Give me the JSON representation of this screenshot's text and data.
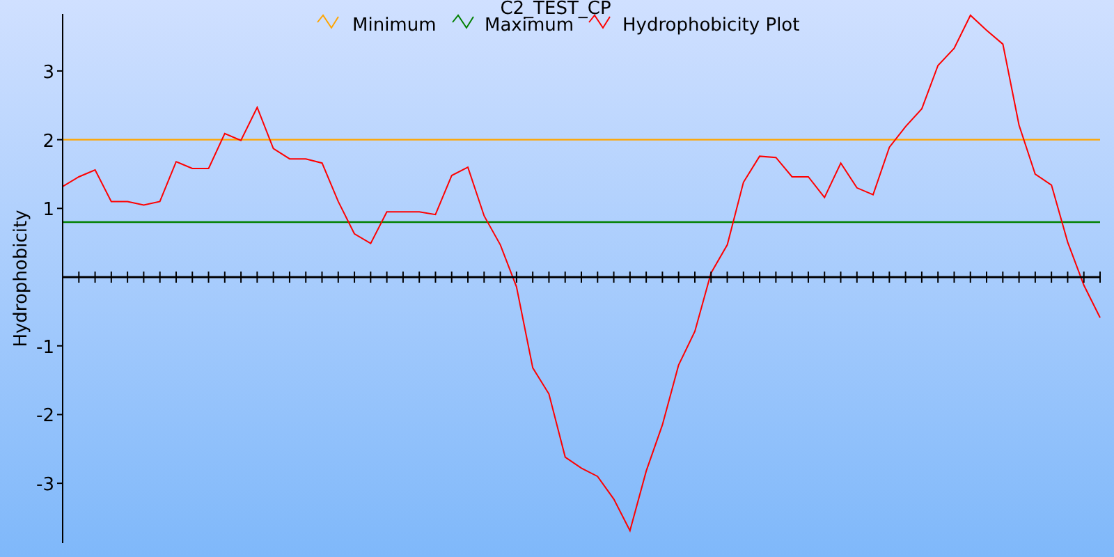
{
  "chart_data": {
    "type": "line",
    "title": "C2_TEST_CP",
    "ylabel": "Hydrophobicity",
    "legend": true,
    "ylim": [
      -3.87,
      3.83
    ],
    "yticks": [
      -3,
      -2,
      -1,
      1,
      2,
      3
    ],
    "series": [
      {
        "name": "Minimum",
        "color": "#ffa500",
        "values": [
          2,
          2,
          2,
          2,
          2,
          2,
          2,
          2,
          2,
          2,
          2,
          2,
          2,
          2,
          2,
          2,
          2,
          2,
          2,
          2,
          2,
          2,
          2,
          2,
          2,
          2,
          2,
          2,
          2,
          2,
          2,
          2,
          2,
          2,
          2,
          2,
          2,
          2,
          2,
          2,
          2,
          2,
          2,
          2,
          2,
          2,
          2,
          2,
          2,
          2,
          2,
          2,
          2,
          2,
          2,
          2,
          2,
          2,
          2,
          2,
          2,
          2,
          2,
          2,
          2
        ]
      },
      {
        "name": "Maximum",
        "color": "#008000",
        "values": [
          0.8,
          0.8,
          0.8,
          0.8,
          0.8,
          0.8,
          0.8,
          0.8,
          0.8,
          0.8,
          0.8,
          0.8,
          0.8,
          0.8,
          0.8,
          0.8,
          0.8,
          0.8,
          0.8,
          0.8,
          0.8,
          0.8,
          0.8,
          0.8,
          0.8,
          0.8,
          0.8,
          0.8,
          0.8,
          0.8,
          0.8,
          0.8,
          0.8,
          0.8,
          0.8,
          0.8,
          0.8,
          0.8,
          0.8,
          0.8,
          0.8,
          0.8,
          0.8,
          0.8,
          0.8,
          0.8,
          0.8,
          0.8,
          0.8,
          0.8,
          0.8,
          0.8,
          0.8,
          0.8,
          0.8,
          0.8,
          0.8,
          0.8,
          0.8,
          0.8,
          0.8,
          0.8,
          0.8,
          0.8,
          0.8
        ]
      },
      {
        "name": "Hydrophobicity Plot",
        "color": "#ff0000",
        "values": [
          1.32,
          1.46,
          1.56,
          1.1,
          1.1,
          1.05,
          1.1,
          1.68,
          1.58,
          1.58,
          2.09,
          1.99,
          2.47,
          1.87,
          1.72,
          1.72,
          1.66,
          1.1,
          0.63,
          0.49,
          0.95,
          0.95,
          0.95,
          0.91,
          1.48,
          1.6,
          0.89,
          0.47,
          -0.14,
          -1.32,
          -1.7,
          -2.62,
          -2.78,
          -2.9,
          -3.23,
          -3.69,
          -2.82,
          -2.15,
          -1.28,
          -0.79,
          0.06,
          0.47,
          1.38,
          1.76,
          1.74,
          1.46,
          1.46,
          1.16,
          1.66,
          1.3,
          1.2,
          1.89,
          2.19,
          2.45,
          3.08,
          3.33,
          3.81,
          3.59,
          3.39,
          2.21,
          1.5,
          1.34,
          0.51,
          -0.12,
          -0.59
        ]
      }
    ]
  }
}
